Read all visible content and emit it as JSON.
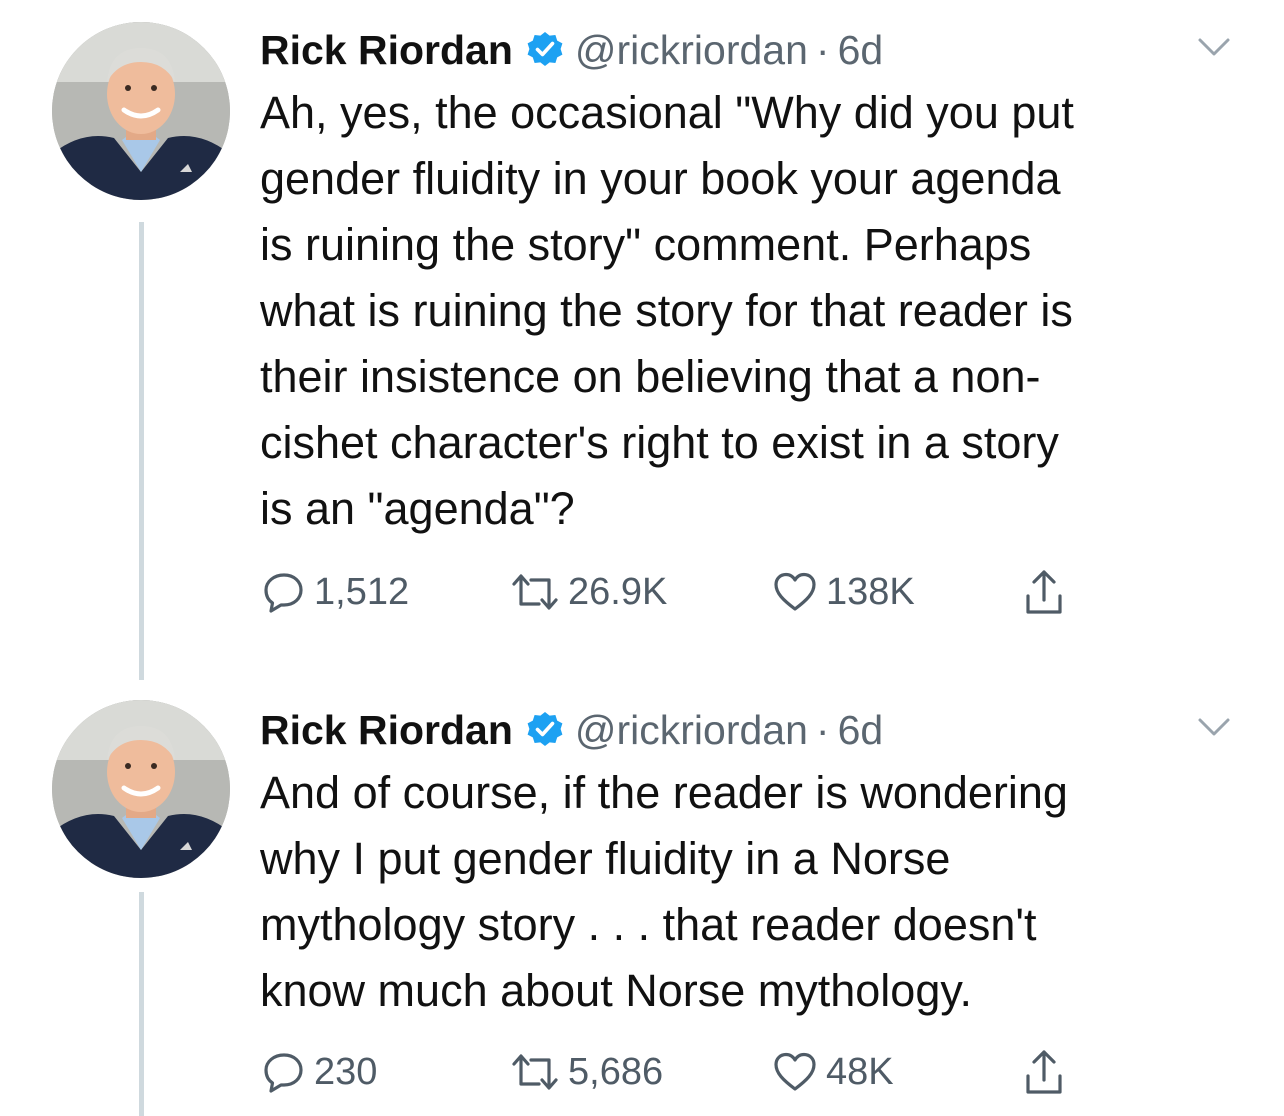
{
  "tweets": [
    {
      "author": {
        "name": "Rick Riordan",
        "handle": "@rickriordan",
        "separator": "·",
        "time": "6d",
        "verified": true
      },
      "lines": [
        "Ah, yes, the occasional \"Why did you put",
        "gender fluidity in your book your agenda",
        "is ruining the story\" comment. Perhaps",
        "what is ruining the story for that reader is",
        "their insistence on believing that a non-",
        "cishet character's right to exist in a story",
        "is an \"agenda\"?"
      ],
      "stats": {
        "replies": "1,512",
        "retweets": "26.9K",
        "likes": "138K"
      }
    },
    {
      "author": {
        "name": "Rick Riordan",
        "handle": "@rickriordan",
        "separator": "·",
        "time": "6d",
        "verified": true
      },
      "lines": [
        "And of course, if the reader is wondering",
        "why I put gender fluidity in a Norse",
        "mythology story . . . that reader doesn't",
        "know much about Norse mythology."
      ],
      "stats": {
        "replies": "230",
        "retweets": "5,686",
        "likes": "48K"
      }
    }
  ],
  "colors": {
    "text": "#111111",
    "secondary_text": "#5b6670",
    "action_icon": "#4f5b66",
    "verified_badge": "#1da1f2",
    "thread_line": "#cfd9de"
  },
  "icons": {
    "verified": "verified-badge-icon",
    "caret": "chevron-down-icon",
    "reply": "reply-icon",
    "retweet": "retweet-icon",
    "like": "heart-icon",
    "share": "share-icon"
  }
}
